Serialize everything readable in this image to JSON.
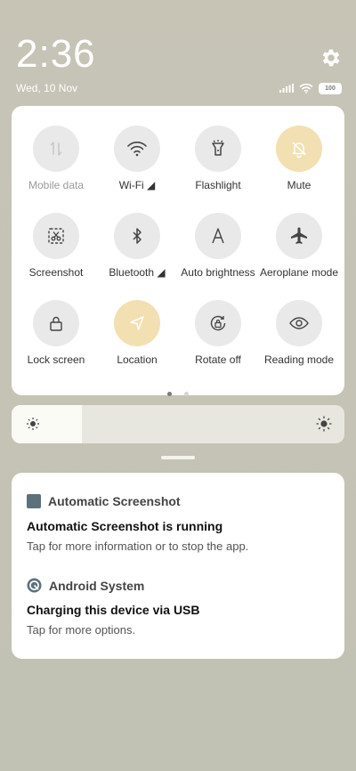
{
  "status": {
    "time": "2:36",
    "date": "Wed, 10 Nov",
    "battery": "100",
    "icons": [
      "signal-icon",
      "wifi-icon",
      "battery-icon"
    ]
  },
  "tiles": [
    {
      "label": "Mobile data",
      "icon": "mobile-data-icon",
      "active": false,
      "disabled": true
    },
    {
      "label": "Wi-Fi ◢",
      "icon": "wifi-icon",
      "active": false
    },
    {
      "label": "Flashlight",
      "icon": "flashlight-icon",
      "active": false
    },
    {
      "label": "Mute",
      "icon": "bell-off-icon",
      "active": true
    },
    {
      "label": "Screenshot",
      "icon": "screenshot-icon",
      "active": false
    },
    {
      "label": "Bluetooth ◢",
      "icon": "bluetooth-icon",
      "active": false
    },
    {
      "label": "Auto brightness",
      "icon": "auto-brightness-icon",
      "active": false
    },
    {
      "label": "Aeroplane mode",
      "icon": "airplane-icon",
      "active": false
    },
    {
      "label": "Lock screen",
      "icon": "lock-icon",
      "active": false
    },
    {
      "label": "Location",
      "icon": "location-icon",
      "active": true
    },
    {
      "label": "Rotate off",
      "icon": "rotate-icon",
      "active": false
    },
    {
      "label": "Reading mode",
      "icon": "eye-icon",
      "active": false
    }
  ],
  "pager": {
    "pages": 2,
    "current": 1
  },
  "brightness": {
    "level": 0.21
  },
  "notifications": [
    {
      "app": "Automatic Screenshot",
      "title": "Automatic Screenshot is running",
      "text": "Tap for more information or to stop the app.",
      "icon": "app-square-icon"
    },
    {
      "app": "Android System",
      "title": "Charging this device via USB",
      "text": "Tap for more options.",
      "icon": "android-system-icon"
    }
  ],
  "colors": {
    "active_tile": "#f3e0b2",
    "inactive_tile": "#e9e9e9",
    "app_square": "#5d717b"
  }
}
